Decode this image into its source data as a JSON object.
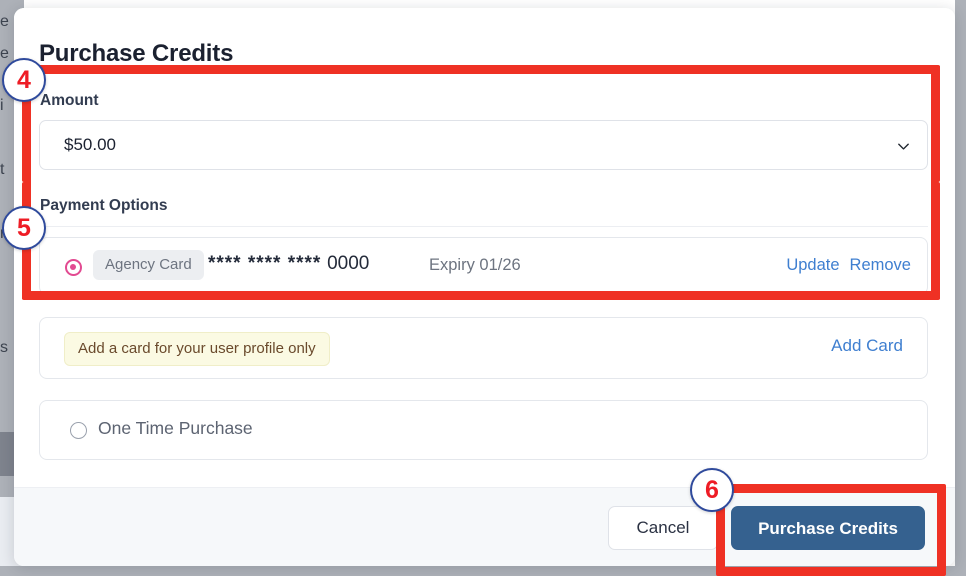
{
  "background": {
    "edge_text_fragments": [
      "e",
      "e",
      "i",
      "t",
      "n",
      "s"
    ]
  },
  "modal": {
    "title": "Purchase Credits",
    "amount": {
      "label": "Amount",
      "value": "$50.00",
      "chevron_icon": "chevron-down-icon"
    },
    "payment_options": {
      "label": "Payment Options",
      "saved_card": {
        "radio_icon": "radio-selected-icon",
        "selected": true,
        "tag": "Agency Card",
        "number_masked": "**** **** ****",
        "number_last4": "0000",
        "expiry": "Expiry 01/26",
        "update_label": "Update",
        "remove_label": "Remove"
      },
      "add_card": {
        "notice": "Add a card for your user profile only",
        "action_label": "Add Card"
      },
      "one_time": {
        "radio_icon": "radio-unselected-icon",
        "selected": false,
        "label": "One Time Purchase"
      }
    },
    "footer": {
      "cancel_label": "Cancel",
      "purchase_label": "Purchase Credits"
    }
  },
  "annotations": {
    "markers": [
      {
        "number": "4"
      },
      {
        "number": "5"
      },
      {
        "number": "6"
      }
    ],
    "highlight_color": "#ef3124",
    "marker_ring_color": "#2f4a9c",
    "marker_text_color": "#ee1c25"
  },
  "colors": {
    "primary_button": "#35618f",
    "link": "#3f7fd0",
    "radio_selected": "#e24a91",
    "notice_bg": "#fbfae3",
    "notice_text": "#6a4a2c",
    "footer_bg": "#f6f8fa"
  }
}
